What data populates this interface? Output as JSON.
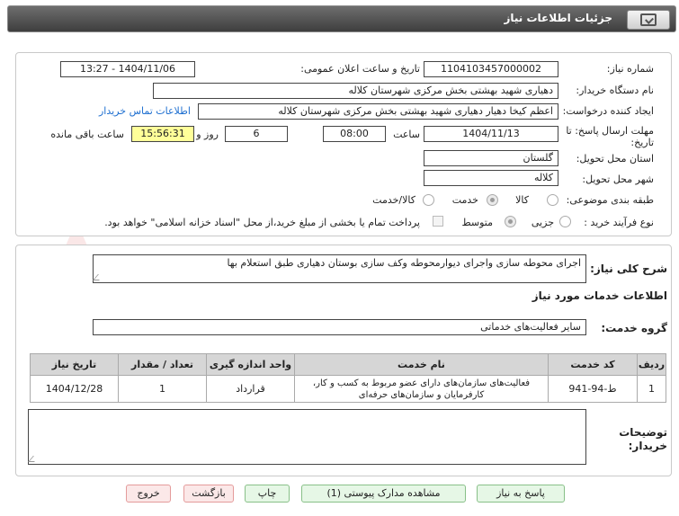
{
  "window": {
    "title": "جزئیات اطلاعات نیاز",
    "icon": "back-list-icon"
  },
  "watermark": {
    "text": "AriaTender.net"
  },
  "fields": {
    "need_number_label": "شماره نیاز:",
    "need_number": "1104103457000002",
    "announce_label": "تاریخ و ساعت اعلان عمومی:",
    "announce_value": "1404/11/06 - 13:27",
    "buyer_label": "نام دستگاه خریدار:",
    "buyer_value": "دهیاری شهید بهشتی بخش مرکزی شهرستان کلاله",
    "creator_label": "ایجاد کننده درخواست:",
    "creator_value": "اعظم کیخا دهیار دهیاری شهید بهشتی بخش مرکزی شهرستان کلاله",
    "contact_link": "اطلاعات تماس خریدار",
    "deadline_label": "مهلت ارسال پاسخ: تا تاریخ:",
    "deadline_date": "1404/11/13",
    "time_label": "ساعت",
    "deadline_time": "08:00",
    "days_value": "6",
    "days_label": "روز و",
    "remaining_time": "15:56:31",
    "remaining_label": "ساعت باقی مانده",
    "province_label": "استان محل تحویل:",
    "province_value": "گلستان",
    "city_label": "شهر محل تحویل:",
    "city_value": "کلاله",
    "category_label": "طبقه بندی موضوعی:",
    "category_options": [
      "کالا",
      "خدمت",
      "کالا/خدمت"
    ],
    "category_selected": "خدمت",
    "purchase_label": "نوع فرآیند خرید :",
    "purchase_options": [
      "جزیی",
      "متوسط"
    ],
    "purchase_selected": "متوسط",
    "payment_note": "پرداخت تمام یا بخشی از مبلغ خرید،از محل \"اسناد خزانه اسلامی\" خواهد بود."
  },
  "section2": {
    "desc_label": "شرح کلی نیاز:",
    "desc_value": "اجرای محوطه سازی واجرای دیوارمحوطه وکف سازی بوستان دهیاری طبق استعلام بها",
    "services_heading": "اطلاعات خدمات مورد نیاز",
    "group_label": "گروه خدمت:",
    "group_value": "سایر فعالیت‌های خدماتی",
    "table": {
      "headers": [
        "ردیف",
        "کد خدمت",
        "نام خدمت",
        "واحد اندازه گیری",
        "تعداد / مقدار",
        "تاریخ نیاز"
      ],
      "rows": [
        [
          "1",
          "ط-94-941",
          "فعالیت‌های سازمان‌های دارای عضو مربوط به کسب و کار، کارفرمایان و سازمان‌های حرفه‌ای",
          "قرارداد",
          "1",
          "1404/12/28"
        ]
      ]
    },
    "buyer_notes_label": "توضیحات خریدار:",
    "buyer_notes_value": ""
  },
  "buttons": {
    "reply": "پاسخ به نیاز",
    "attachments": "مشاهده مدارک پیوستی (1)",
    "print": "چاپ",
    "back": "بازگشت",
    "exit": "خروج"
  },
  "colors": {
    "accent": "#1e6fd0",
    "remaining_bg": "#ffff99",
    "button_green": "#e6f7e6",
    "button_red": "#fbe8e8"
  }
}
